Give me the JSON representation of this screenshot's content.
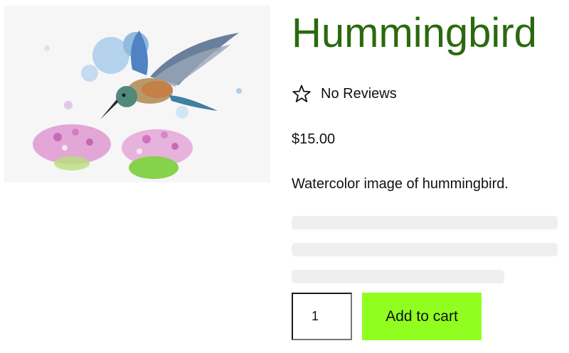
{
  "product": {
    "title": "Hummingbird",
    "reviews_label": "No Reviews",
    "price": "$15.00",
    "description": "Watercolor image of hummingbird.",
    "quantity": "1",
    "add_to_cart_label": "Add to cart"
  },
  "icons": {
    "rating": "star-outline-icon"
  },
  "colors": {
    "title": "#2a6a0e",
    "add_to_cart": "#90ff1f",
    "skeleton": "#efefef"
  }
}
